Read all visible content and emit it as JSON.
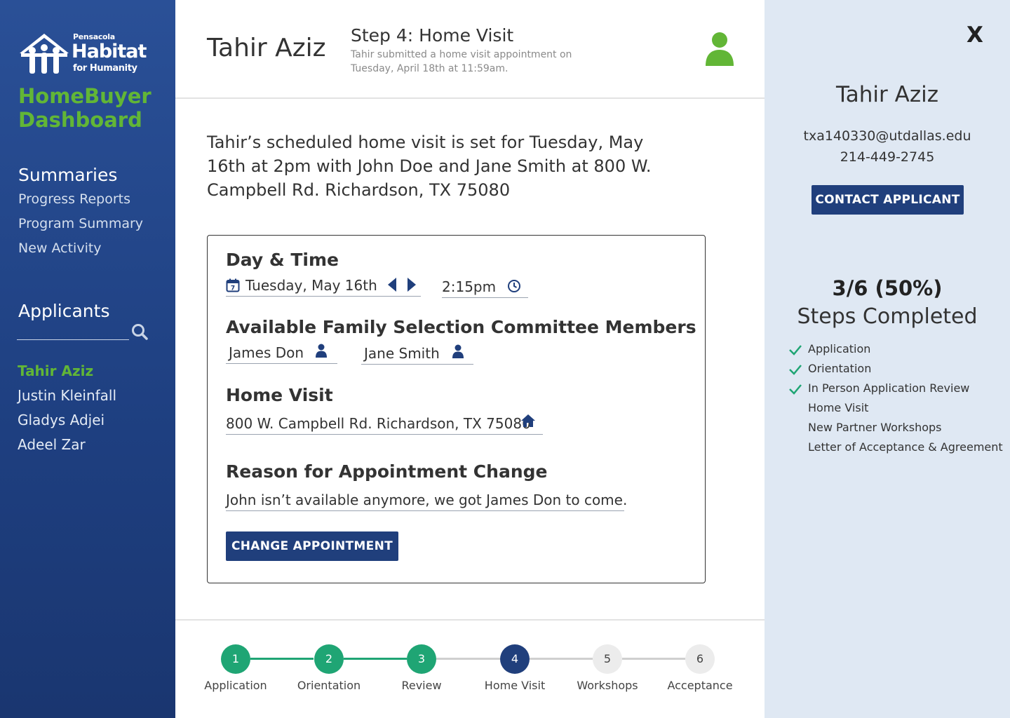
{
  "colors": {
    "sidebar_bg": "#2a5097",
    "brand_green": "#62b636",
    "primary_button": "#203f7c",
    "step_done": "#1fa574",
    "step_current": "#203f7c",
    "step_todo": "#ececec",
    "right_panel_bg": "#dfe8f3"
  },
  "sidebar": {
    "logo": {
      "line1": "Pensacola",
      "line2": "Habitat",
      "line3": "for Humanity"
    },
    "app_title": "HomeBuyer Dashboard",
    "summaries_title": "Summaries",
    "summary_links": [
      "Progress Reports",
      "Program Summary",
      "New Activity"
    ],
    "applicants_title": "Applicants",
    "search_icon": "search-icon",
    "applicants": [
      "Tahir Aziz",
      "Justin Kleinfall",
      "Gladys Adjei",
      "Adeel Zar"
    ],
    "active_applicant": "Tahir Aziz"
  },
  "header": {
    "applicant_name": "Tahir Aziz",
    "step_title": "Step 4: Home Visit",
    "step_subtitle": "Tahir submitted a home visit appointment on Tuesday, April 18th at 11:59am.",
    "avatar_icon": "user-icon"
  },
  "main": {
    "summary": "Tahir’s scheduled home visit is set for Tuesday, May 16th at 2pm with John Doe and Jane Smith at 800 W. Campbell Rd. Richardson, TX 75080"
  },
  "form": {
    "day_time_label": "Day & Time",
    "date_value": "Tuesday, May 16th",
    "time_value": "2:15pm",
    "committee_label": "Available Family Selection Committee Members",
    "members": [
      "James Don",
      "Jane Smith"
    ],
    "home_visit_label": "Home Visit",
    "address_value": "800 W. Campbell Rd. Richardson, TX 75080",
    "reason_label": "Reason for Appointment Change",
    "reason_value": "John isn’t available anymore, we got James Don to come.",
    "submit_label": "CHANGE APPOINTMENT"
  },
  "progress": {
    "current_step": 4,
    "steps": [
      {
        "number": "1",
        "label": "Application",
        "status": "done"
      },
      {
        "number": "2",
        "label": "Orientation",
        "status": "done"
      },
      {
        "number": "3",
        "label": "Review",
        "status": "done"
      },
      {
        "number": "4",
        "label": "Home Visit",
        "status": "current"
      },
      {
        "number": "5",
        "label": "Workshops",
        "status": "todo"
      },
      {
        "number": "6",
        "label": "Acceptance",
        "status": "todo"
      }
    ]
  },
  "right_panel": {
    "close_label": "X",
    "name": "Tahir Aziz",
    "email": "txa140330@utdallas.edu",
    "phone": "214-449-2745",
    "contact_label": "CONTACT APPLICANT",
    "fraction": "3/6 (50%)",
    "steps_title": "Steps Completed",
    "checklist": [
      {
        "label": "Application",
        "checked": true
      },
      {
        "label": "Orientation",
        "checked": true
      },
      {
        "label": "In Person Application Review",
        "checked": true
      },
      {
        "label": "Home Visit",
        "checked": false
      },
      {
        "label": "New Partner Workshops",
        "checked": false
      },
      {
        "label": "Letter of Acceptance & Agreement",
        "checked": false
      }
    ]
  }
}
